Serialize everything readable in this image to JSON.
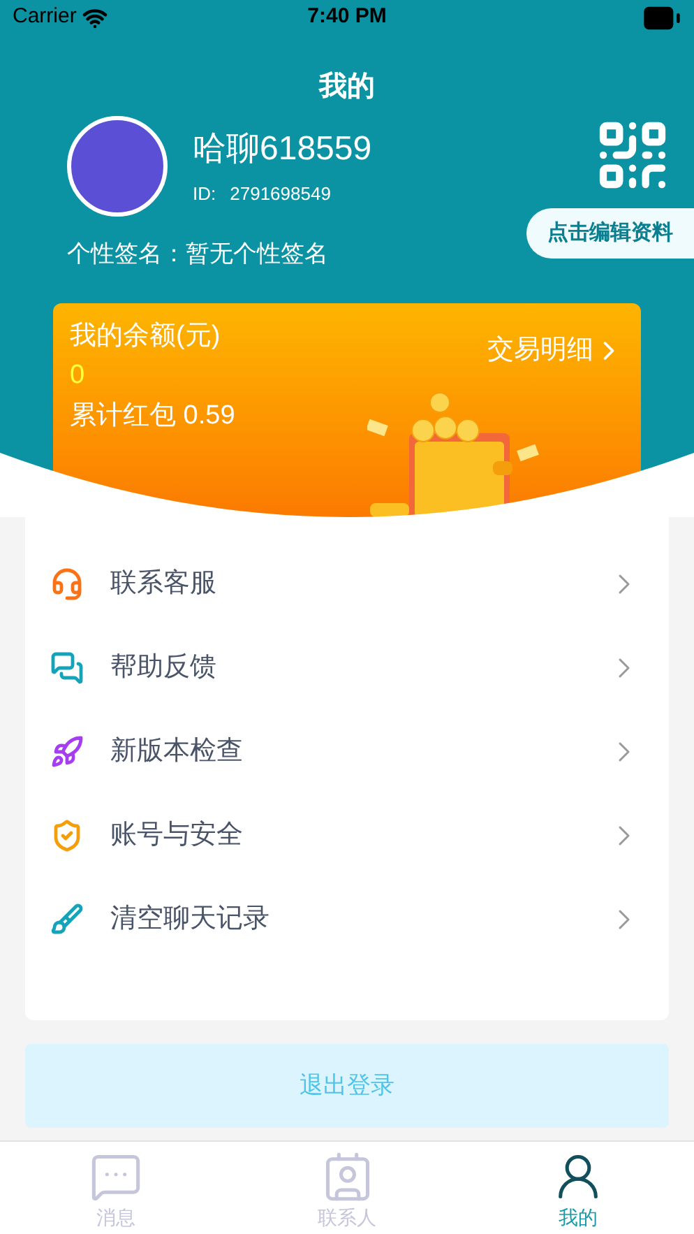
{
  "status_bar": {
    "carrier": "Carrier",
    "time": "7:40 PM"
  },
  "title": "我的",
  "profile": {
    "name": "哈聊618559",
    "id_label": "ID:",
    "id": "2791698549",
    "signature_label": "个性签名：",
    "signature": "暂无个性签名",
    "edit_button": "点击编辑资料"
  },
  "wallet": {
    "balance_label": "我的余额(元)",
    "balance": "0",
    "red_packet": "累计红包 0.59",
    "details_link": "交易明细"
  },
  "menu": [
    {
      "label": "联系客服",
      "kind": "support"
    },
    {
      "label": "帮助反馈",
      "kind": "feedback"
    },
    {
      "label": "新版本检查",
      "kind": "update"
    },
    {
      "label": "账号与安全",
      "kind": "security"
    },
    {
      "label": "清空聊天记录",
      "kind": "clear"
    }
  ],
  "logout": "退出登录",
  "tabs": [
    {
      "label": "消息",
      "kind": "messages",
      "selected": false
    },
    {
      "label": "联系人",
      "kind": "contacts",
      "selected": false
    },
    {
      "label": "我的",
      "kind": "me",
      "selected": true
    }
  ]
}
